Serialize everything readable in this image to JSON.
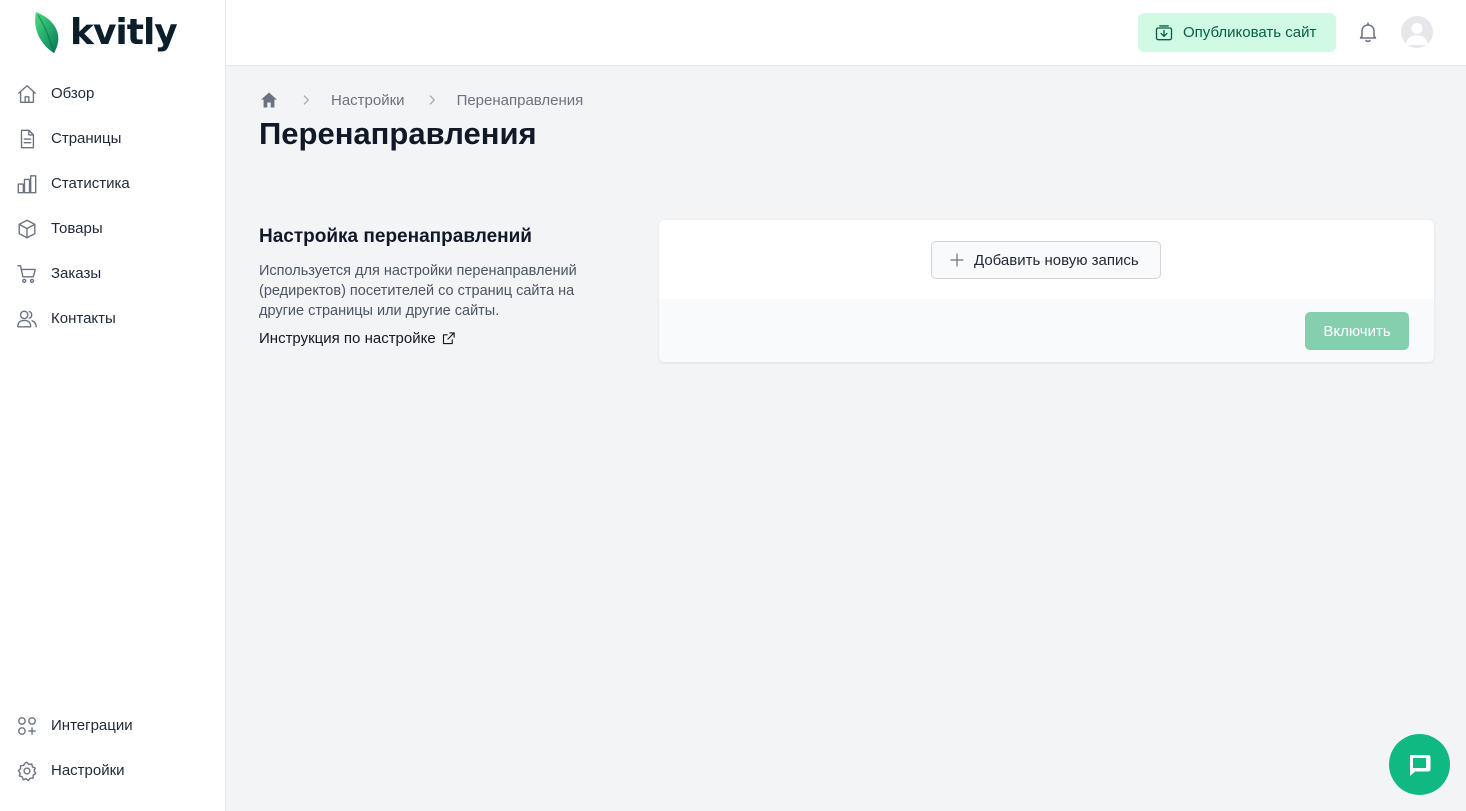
{
  "brand": {
    "name": "kvitly",
    "accent": "#10b981",
    "logo_icon": "leaf-icon"
  },
  "sidebar": {
    "items": [
      {
        "label": "Обзор",
        "icon": "home-icon"
      },
      {
        "label": "Страницы",
        "icon": "document-icon"
      },
      {
        "label": "Статистика",
        "icon": "chart-icon"
      },
      {
        "label": "Товары",
        "icon": "box-icon"
      },
      {
        "label": "Заказы",
        "icon": "cart-icon"
      },
      {
        "label": "Контакты",
        "icon": "users-icon"
      }
    ],
    "bottom_items": [
      {
        "label": "Интеграции",
        "icon": "integrations-icon"
      },
      {
        "label": "Настройки",
        "icon": "gear-icon"
      }
    ]
  },
  "topbar": {
    "publish_label": "Опубликовать сайт",
    "publish_color": "#d1fae5",
    "bell_icon": "bell-icon",
    "avatar_icon": "avatar-icon"
  },
  "breadcrumb": {
    "home_icon": "home-icon",
    "items": [
      "Настройки",
      "Перенаправления"
    ]
  },
  "page": {
    "title": "Перенаправления"
  },
  "section": {
    "title": "Настройка перенаправлений",
    "description": "Используется для настройки перенаправлений (редиректов) посетителей со страниц сайта на другие страницы или другие сайты.",
    "link_label": "Инструкция по настройке",
    "link_icon": "external-link-icon"
  },
  "card": {
    "add_label": "Добавить новую запись",
    "add_icon": "plus-icon",
    "enable_label": "Включить",
    "enable_color": "#86cfae"
  },
  "chat": {
    "icon": "chat-icon"
  }
}
